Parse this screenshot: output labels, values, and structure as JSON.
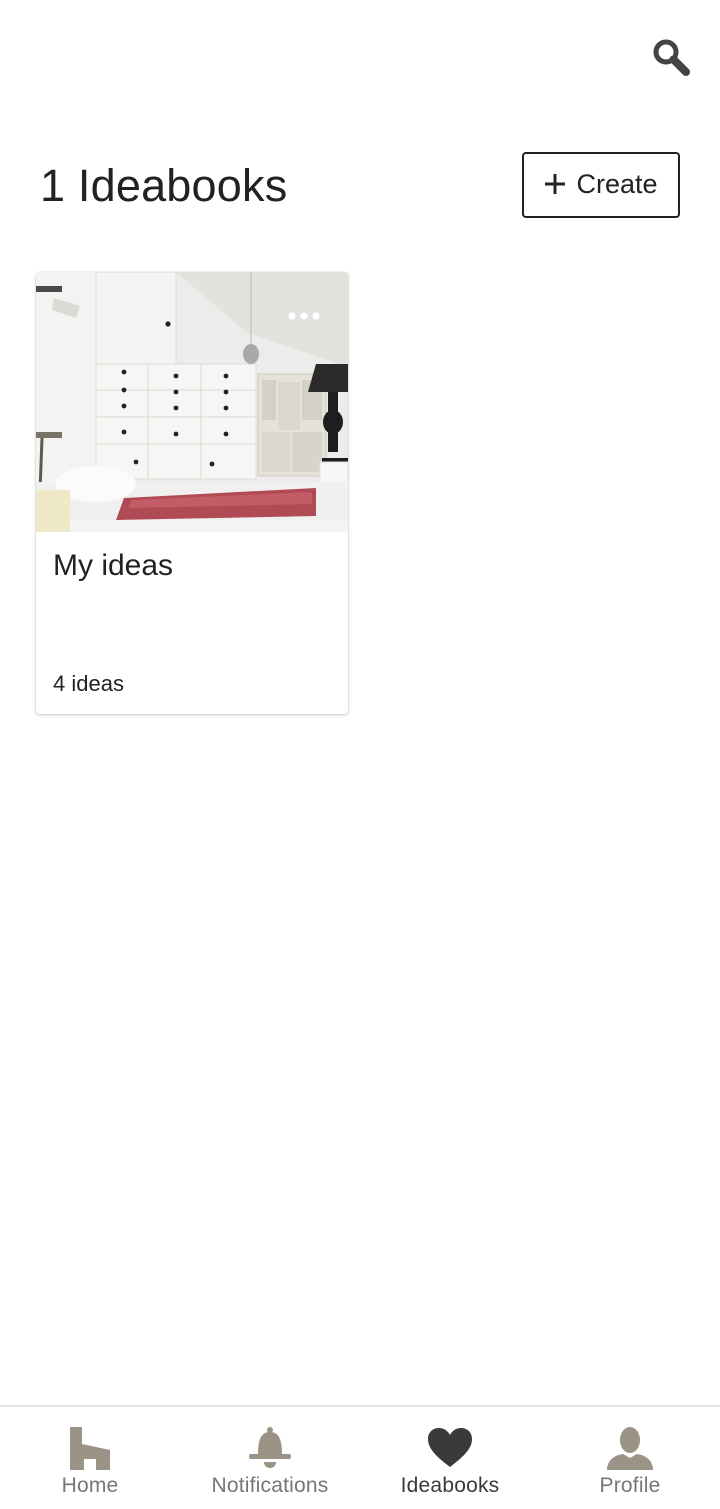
{
  "header": {
    "title": "1 Ideabooks",
    "search_icon": "search-icon",
    "create_label": "Create",
    "create_icon": "plus-icon"
  },
  "ideabooks": [
    {
      "title": "My ideas",
      "count_label": "4 ideas",
      "cover": "bedroom-photo",
      "menu_icon": "more-horizontal-icon"
    }
  ],
  "bottom_nav": {
    "items": [
      {
        "label": "Home",
        "icon": "home-icon",
        "active": false
      },
      {
        "label": "Notifications",
        "icon": "bell-icon",
        "active": false
      },
      {
        "label": "Ideabooks",
        "icon": "heart-icon",
        "active": true
      },
      {
        "label": "Profile",
        "icon": "person-icon",
        "active": false
      }
    ]
  },
  "colors": {
    "text": "#222222",
    "nav_inactive": "#9b9385",
    "nav_active": "#3a3a3a",
    "nav_label": "#767676"
  }
}
